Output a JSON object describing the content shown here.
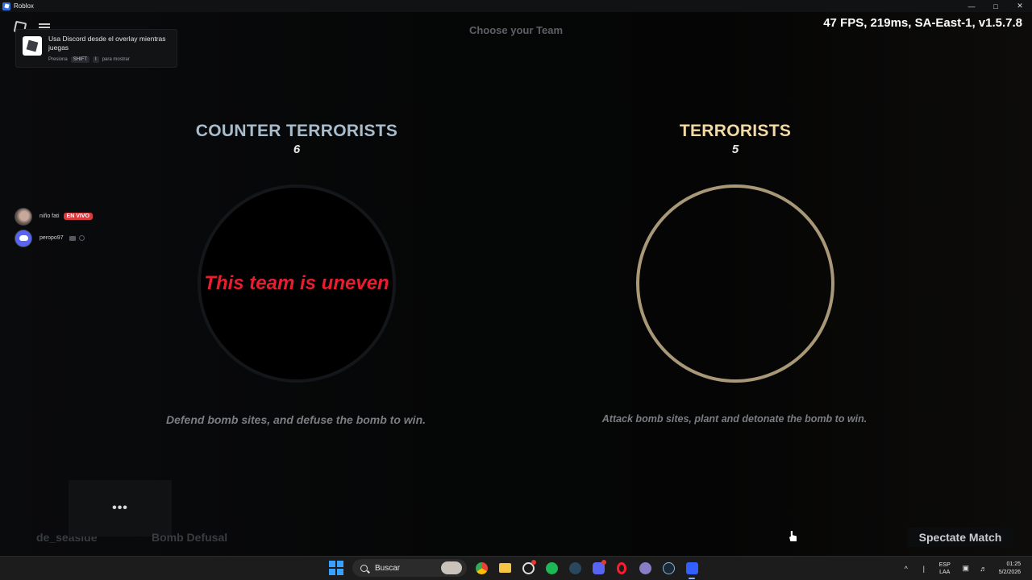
{
  "window": {
    "title": "Roblox",
    "minimize": "—",
    "maximize": "□",
    "close": "✕"
  },
  "hud": {
    "choose_title": "Choose your Team",
    "stats": "47 FPS, 219ms, SA-East-1, v1.5.7.8"
  },
  "discord_toast": {
    "message": "Usa Discord desde el overlay mientras juegas",
    "hint_prefix": "Presiona",
    "key1": "SHIFT",
    "key2": "I",
    "hint_suffix": "para mostrar"
  },
  "voice": {
    "users": [
      {
        "name": "niño fati",
        "badge": "EN VIVO"
      },
      {
        "name": "peropo97"
      }
    ]
  },
  "teams": {
    "ct": {
      "name": "COUNTER TERRORISTS",
      "count": "6",
      "status": "This team is uneven",
      "description": "Defend bomb sites, and defuse the bomb to win.",
      "color": "#a9bccc"
    },
    "t": {
      "name": "TERRORISTS",
      "count": "5",
      "description": "Attack bomb sites, plant and detonate the bomb to win.",
      "color": "#f3d9a2",
      "ring_color": "#a89877"
    }
  },
  "bottom": {
    "more": "•••",
    "map": "de_seaside",
    "mode": "Bomb Defusal",
    "spectate": "Spectate Match"
  },
  "taskbar": {
    "search_placeholder": "Buscar",
    "apps": [
      "windows-start-icon",
      "chrome-icon",
      "file-explorer-icon",
      "github-icon",
      "spotify-icon",
      "steam-icon",
      "discord-icon",
      "opera-icon",
      "notes-app-icon",
      "steam-alt-icon",
      "roblox-icon"
    ],
    "lang_top": "ESP",
    "lang_bottom": "LAA",
    "time": "01:25",
    "date": "5/2/2026"
  },
  "colors": {
    "uneven": "#e81e2e",
    "live_badge": "#d83c3e",
    "discord_blurple": "#5865f2"
  }
}
